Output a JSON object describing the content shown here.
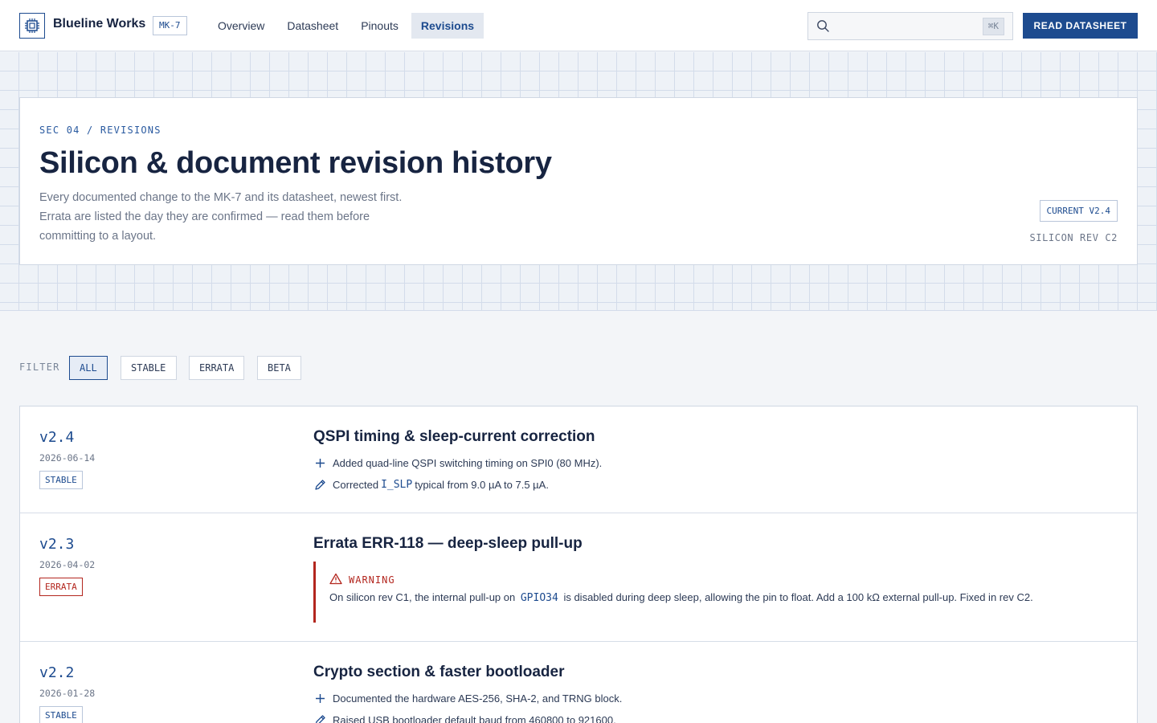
{
  "header": {
    "brand": "Blueline Works",
    "model_badge": "MK-7",
    "nav": [
      "Overview",
      "Datasheet",
      "Pinouts",
      "Revisions"
    ],
    "active_nav": "Revisions",
    "search": {
      "placeholder": "",
      "shortcut": "⌘K"
    },
    "cta_label": "READ DATASHEET"
  },
  "hero": {
    "kicker": "SEC 04 / REVISIONS",
    "title": "Silicon & document revision history",
    "description": "Every documented change to the MK-7 and its datasheet, newest first. Errata are listed the day they are confirmed — read them before committing to a layout.",
    "current_badge": "CURRENT V2.4",
    "silicon_rev": "SILICON REV C2"
  },
  "filter": {
    "label": "FILTER",
    "chips": [
      "ALL",
      "STABLE",
      "ERRATA",
      "BETA"
    ],
    "active": "ALL"
  },
  "revisions": [
    {
      "version": "v2.4",
      "date": "2026-06-14",
      "status": "STABLE",
      "title": "QSPI timing & sleep-current correction",
      "changes": [
        {
          "icon": "plus-icon",
          "text": "Added quad-line QSPI switching timing on SPI0 (80 MHz)."
        },
        {
          "icon": "pencil-icon",
          "pre": "Corrected",
          "code": "I_SLP",
          "post": "typical from 9.0 µA to 7.5 µA."
        }
      ]
    },
    {
      "version": "v2.3",
      "date": "2026-04-02",
      "status": "ERRATA",
      "title": "Errata ERR-118 — deep-sleep pull-up",
      "warning": {
        "icon": "warning-triangle-icon",
        "label": "WARNING",
        "pre": "On silicon rev C1, the internal pull-up on",
        "code": "GPIO34",
        "post": "is disabled during deep sleep, allowing the pin to float. Add a 100 kΩ external pull-up. Fixed in rev C2."
      }
    },
    {
      "version": "v2.2",
      "date": "2026-01-28",
      "status": "STABLE",
      "title": "Crypto section & faster bootloader",
      "changes": [
        {
          "icon": "plus-icon",
          "text": "Documented the hardware AES-256, SHA-2, and TRNG block."
        },
        {
          "icon": "pencil-icon",
          "text": "Raised USB bootloader default baud from 460800 to 921600."
        }
      ]
    }
  ],
  "colors": {
    "accent": "#1d4b8f",
    "errata": "#b3261e",
    "text": "#172441",
    "muted": "#6b7588",
    "grid": "#d3dcea"
  }
}
